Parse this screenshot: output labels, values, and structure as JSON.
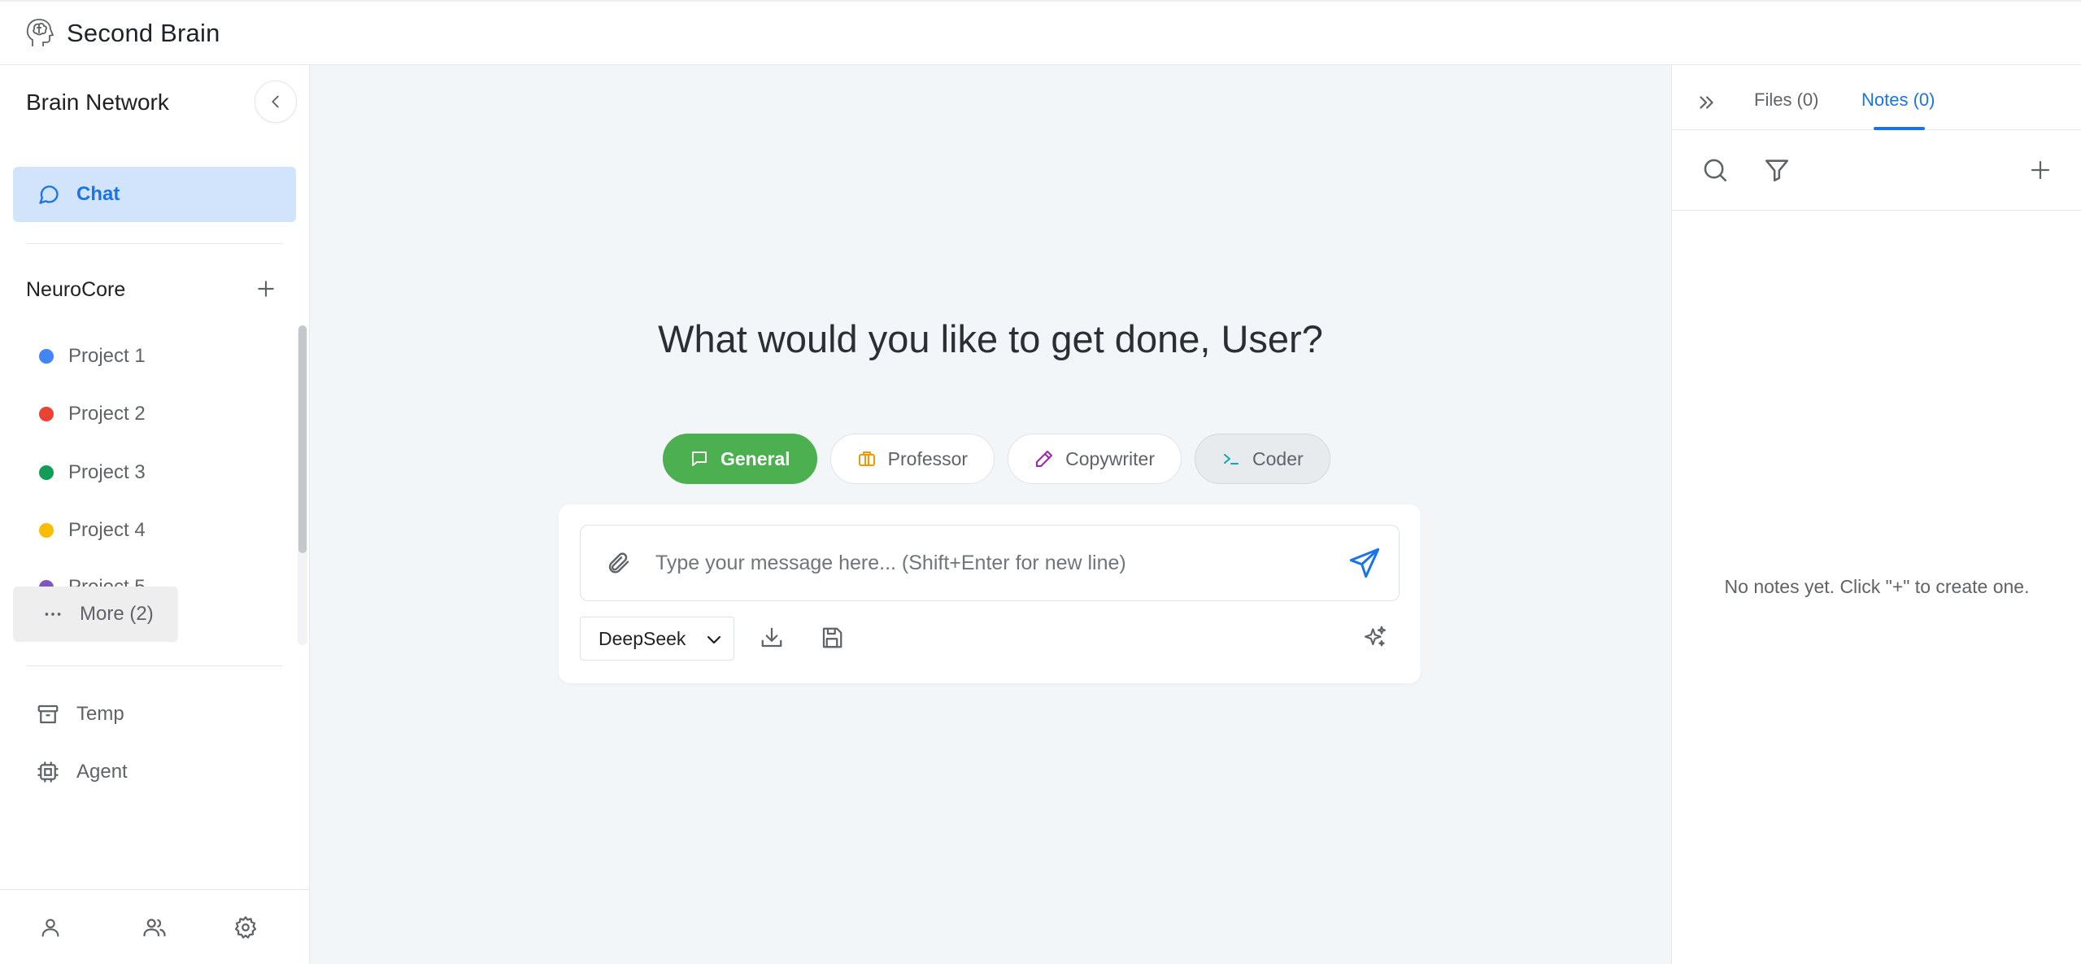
{
  "app": {
    "title": "Second Brain",
    "logo_icon": "brain-head-icon"
  },
  "sidebar": {
    "header": "Brain Network",
    "chat_label": "Chat",
    "section_title": "NeuroCore",
    "projects": [
      {
        "name": "Project 1",
        "color": "#4285f4"
      },
      {
        "name": "Project 2",
        "color": "#ea4335"
      },
      {
        "name": "Project 3",
        "color": "#0f9d58"
      },
      {
        "name": "Project 4",
        "color": "#fbbc04"
      },
      {
        "name": "Project 5",
        "color": "#7e57c2"
      }
    ],
    "more_label": "More (2)",
    "nav": [
      {
        "label": "Temp",
        "icon": "archive-icon"
      },
      {
        "label": "Agent",
        "icon": "cpu-icon"
      }
    ],
    "footer_icons": [
      "user-icon",
      "users-icon",
      "settings-icon"
    ]
  },
  "main": {
    "headline": "What would you like to get done, User?",
    "modes": [
      {
        "label": "General",
        "icon": "message-icon",
        "color": "#4caf50",
        "active": true
      },
      {
        "label": "Professor",
        "icon": "briefcase-icon",
        "color": "#f29900"
      },
      {
        "label": "Copywriter",
        "icon": "pencil-icon",
        "color": "#9c27b0"
      },
      {
        "label": "Coder",
        "icon": "terminal-icon",
        "color": "#12a4b8"
      }
    ],
    "composer": {
      "placeholder": "Type your message here... (Shift+Enter for new line)",
      "model": "DeepSeek"
    }
  },
  "right_panel": {
    "tabs": [
      {
        "label": "Files (0)"
      },
      {
        "label": "Notes (0)",
        "active": true
      }
    ],
    "empty_text": "No notes yet. Click \"+\" to create one."
  },
  "colors": {
    "accent": "#1a73e8",
    "chat_bg": "#d2e3fc",
    "general": "#4caf50",
    "main_bg": "#f3f6f9"
  }
}
